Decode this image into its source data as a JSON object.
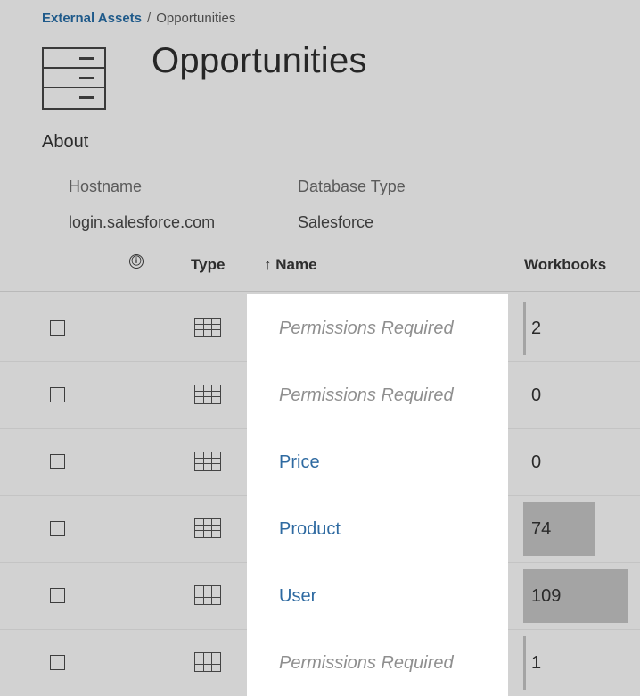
{
  "breadcrumb": {
    "parent": "External Assets",
    "separator": "/",
    "current": "Opportunities"
  },
  "page": {
    "title": "Opportunities"
  },
  "about": {
    "heading": "About",
    "hostname_label": "Hostname",
    "hostname_value": "login.salesforce.com",
    "dbtype_label": "Database Type",
    "dbtype_value": "Salesforce"
  },
  "table": {
    "headers": {
      "info": "ⓘ",
      "type": "Type",
      "sort_arrow": "↑",
      "name": "Name",
      "workbooks": "Workbooks"
    },
    "max_workbooks": 109,
    "rows": [
      {
        "name": "Permissions Required",
        "permission_required": true,
        "workbooks": "2",
        "workbooks_count": 2
      },
      {
        "name": "Permissions Required",
        "permission_required": true,
        "workbooks": "0",
        "workbooks_count": 0
      },
      {
        "name": "Price",
        "permission_required": false,
        "workbooks": "0",
        "workbooks_count": 0
      },
      {
        "name": "Product",
        "permission_required": false,
        "workbooks": "74",
        "workbooks_count": 74
      },
      {
        "name": "User",
        "permission_required": false,
        "workbooks": "109",
        "workbooks_count": 109
      },
      {
        "name": "Permissions Required",
        "permission_required": true,
        "workbooks": "1",
        "workbooks_count": 1
      }
    ]
  },
  "colors": {
    "background": "#d2d2d2",
    "name_cell": "#ffffff",
    "link": "#2e6aa1",
    "bar": "#a4a4a4"
  }
}
